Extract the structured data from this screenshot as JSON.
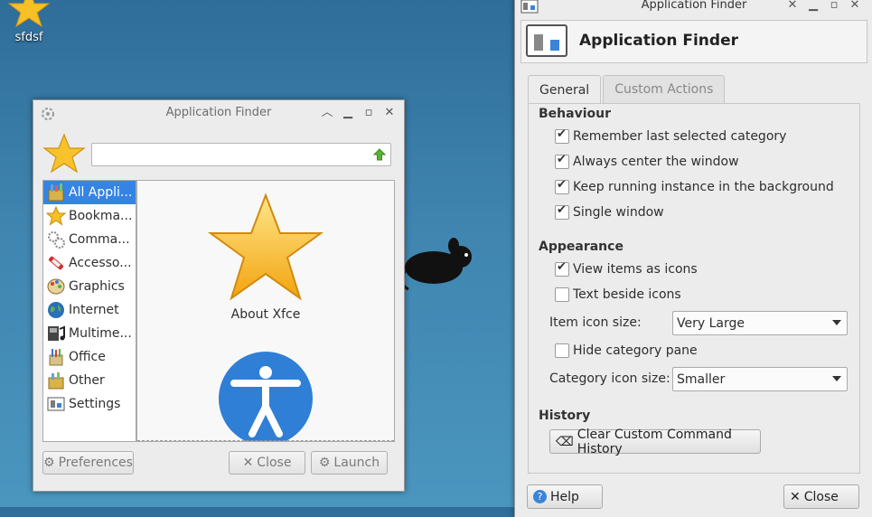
{
  "desktop": {
    "icon_label": "sfdsf"
  },
  "left_window": {
    "title": "Application Finder",
    "search_value": "",
    "categories": [
      {
        "label": "All Appli...",
        "icon": "all-apps-icon",
        "selected": true
      },
      {
        "label": "Bookma...",
        "icon": "star-icon"
      },
      {
        "label": "Comma...",
        "icon": "gears-icon"
      },
      {
        "label": "Accesso...",
        "icon": "accessories-icon"
      },
      {
        "label": "Graphics",
        "icon": "graphics-icon"
      },
      {
        "label": "Internet",
        "icon": "globe-icon"
      },
      {
        "label": "Multime...",
        "icon": "multimedia-icon"
      },
      {
        "label": "Office",
        "icon": "office-icon"
      },
      {
        "label": "Other",
        "icon": "other-icon"
      },
      {
        "label": "Settings",
        "icon": "settings-icon"
      }
    ],
    "apps": [
      {
        "label": "About Xfce",
        "icon": "star-icon"
      },
      {
        "label": "",
        "icon": "accessibility-icon"
      }
    ],
    "buttons": {
      "preferences": "Preferences",
      "close": "Close",
      "launch": "Launch"
    }
  },
  "right_window": {
    "title": "Application Finder",
    "header_title": "Application Finder",
    "tabs": [
      "General",
      "Custom Actions"
    ],
    "behaviour": {
      "heading": "Behaviour",
      "options": [
        {
          "label": "Remember last selected category",
          "checked": true
        },
        {
          "label": "Always center the window",
          "checked": true
        },
        {
          "label": "Keep running instance in the background",
          "checked": true
        },
        {
          "label": "Single window",
          "checked": true
        }
      ]
    },
    "appearance": {
      "heading": "Appearance",
      "view_icons": {
        "label": "View items as icons",
        "checked": true
      },
      "text_beside": {
        "label": "Text beside icons",
        "checked": false
      },
      "item_icon_size_label": "Item icon size:",
      "item_icon_size_value": "Very Large",
      "hide_category": {
        "label": "Hide category pane",
        "checked": false
      },
      "category_icon_size_label": "Category icon size:",
      "category_icon_size_value": "Smaller"
    },
    "history": {
      "heading": "History",
      "clear_button": "Clear Custom Command History"
    },
    "buttons": {
      "help": "Help",
      "close": "Close"
    }
  }
}
